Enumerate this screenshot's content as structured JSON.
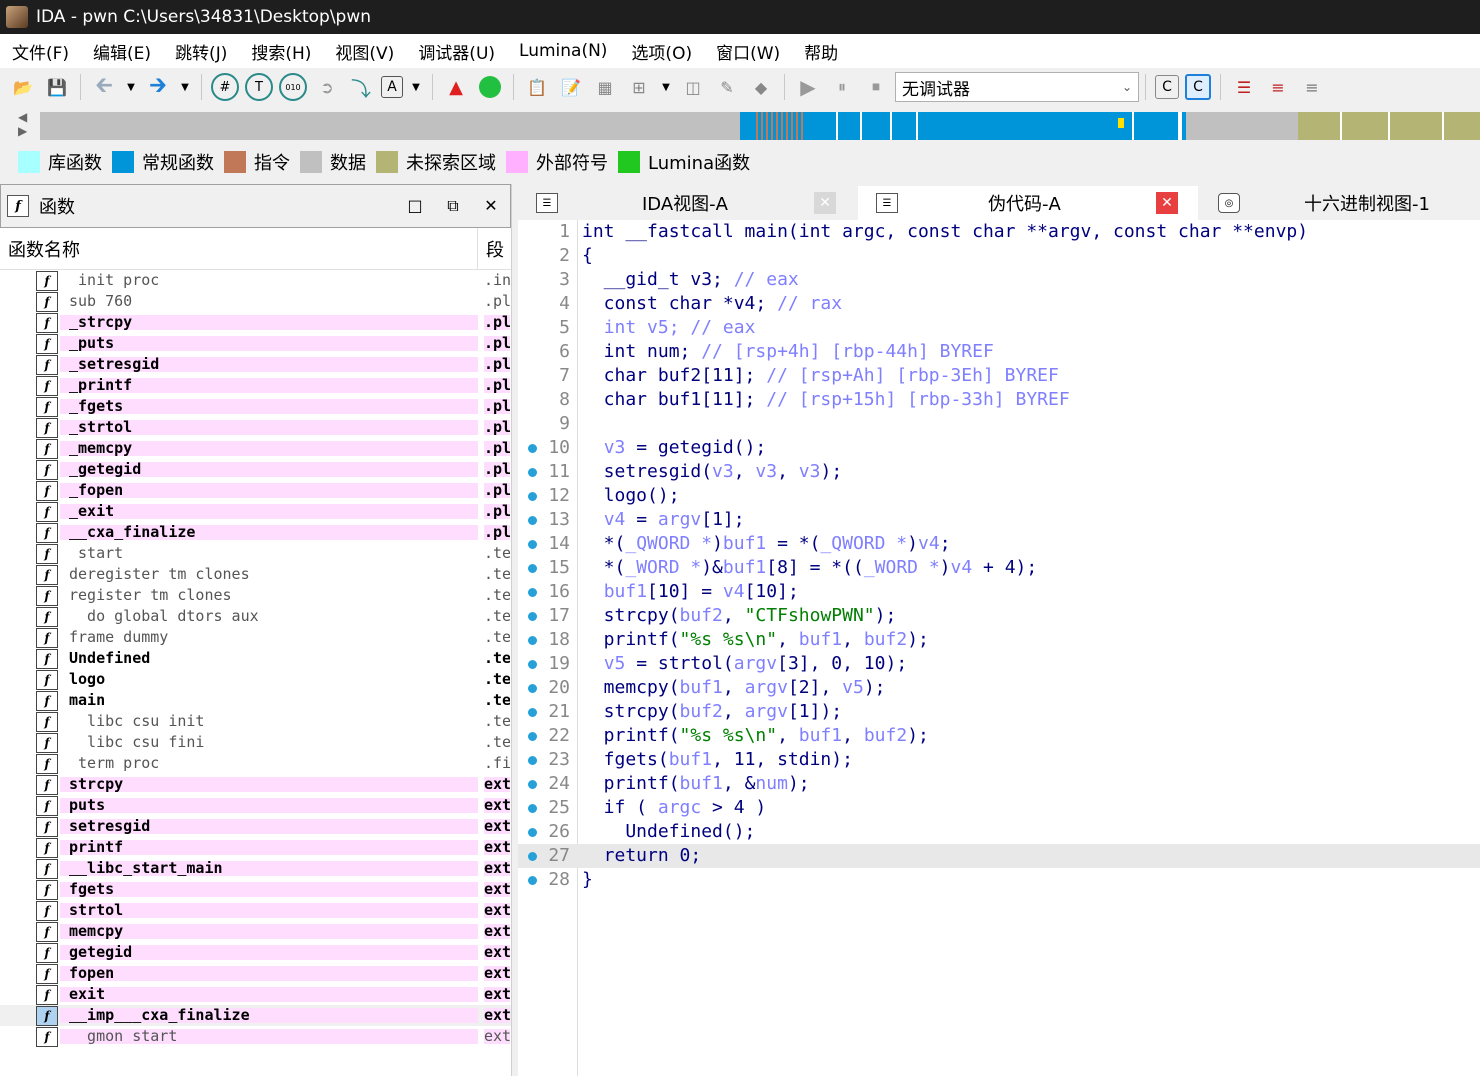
{
  "window": {
    "title": "IDA - pwn C:\\Users\\34831\\Desktop\\pwn"
  },
  "menu": [
    "文件(F)",
    "编辑(E)",
    "跳转(J)",
    "搜索(H)",
    "视图(V)",
    "调试器(U)",
    "Lumina(N)",
    "选项(O)",
    "窗口(W)",
    "帮助"
  ],
  "toolbar": {
    "icons": [
      "open-icon",
      "save-icon",
      "back-icon",
      "dropdown-icon",
      "forward-icon",
      "dropdown-icon",
      "hex-icon",
      "text-icon",
      "binary-icon",
      "jump-icon",
      "step-icon",
      "string-icon",
      "dropdown-icon",
      "graph-icon",
      "green-circle-icon",
      "copy-icon",
      "paste-icon",
      "struct-icon",
      "add-icon",
      "dropdown-icon",
      "bookmark-icon",
      "edit-icon",
      "marker-icon",
      "play-icon",
      "pause-icon",
      "stop-icon"
    ],
    "debugger_select": "无调试器",
    "right_icons": [
      "c-icon",
      "c-refresh-icon",
      "list-icon",
      "list-red-icon",
      "list-gray-icon"
    ]
  },
  "legend": [
    {
      "label": "库函数",
      "color": "#a8ffff"
    },
    {
      "label": "常规函数",
      "color": "#0094d8"
    },
    {
      "label": "指令",
      "color": "#c07858"
    },
    {
      "label": "数据",
      "color": "#c0c0c0"
    },
    {
      "label": "未探索区域",
      "color": "#b4b474"
    },
    {
      "label": "外部符号",
      "color": "#ffb0ff"
    },
    {
      "label": "Lumina函数",
      "color": "#20c820"
    }
  ],
  "functions_panel": {
    "title": "函数",
    "col_name": "函数名称",
    "col_segment": "段",
    "rows": [
      {
        "name": "_init_proc",
        "seg": ".init",
        "style": "gray"
      },
      {
        "name": "sub_760",
        "seg": ".plt",
        "style": "gray"
      },
      {
        "name": "_strcpy",
        "seg": ".plt",
        "style": "pink"
      },
      {
        "name": "_puts",
        "seg": ".plt",
        "style": "pink"
      },
      {
        "name": "_setresgid",
        "seg": ".plt",
        "style": "pink"
      },
      {
        "name": "_printf",
        "seg": ".plt",
        "style": "pink"
      },
      {
        "name": "_fgets",
        "seg": ".plt",
        "style": "pink"
      },
      {
        "name": "_strtol",
        "seg": ".plt",
        "style": "pink"
      },
      {
        "name": "_memcpy",
        "seg": ".plt",
        "style": "pink"
      },
      {
        "name": "_getegid",
        "seg": ".plt",
        "style": "pink"
      },
      {
        "name": "_fopen",
        "seg": ".plt",
        "style": "pink"
      },
      {
        "name": "_exit",
        "seg": ".plt",
        "style": "pink"
      },
      {
        "name": "__cxa_finalize",
        "seg": ".plt",
        "style": "pink"
      },
      {
        "name": "_start",
        "seg": ".text",
        "style": "gray"
      },
      {
        "name": "deregister_tm_clones",
        "seg": ".text",
        "style": "gray"
      },
      {
        "name": "register_tm_clones",
        "seg": ".text",
        "style": "gray"
      },
      {
        "name": "__do_global_dtors_aux",
        "seg": ".text",
        "style": "gray"
      },
      {
        "name": "frame_dummy",
        "seg": ".text",
        "style": "gray"
      },
      {
        "name": "Undefined",
        "seg": ".text",
        "style": "bold"
      },
      {
        "name": "logo",
        "seg": ".text",
        "style": "bold"
      },
      {
        "name": "main",
        "seg": ".text",
        "style": "bold"
      },
      {
        "name": "__libc_csu_init",
        "seg": ".text",
        "style": "gray"
      },
      {
        "name": "__libc_csu_fini",
        "seg": ".text",
        "style": "gray"
      },
      {
        "name": "_term_proc",
        "seg": ".fini",
        "style": "gray"
      },
      {
        "name": "strcpy",
        "seg": "extern",
        "style": "pink"
      },
      {
        "name": "puts",
        "seg": "extern",
        "style": "pink"
      },
      {
        "name": "setresgid",
        "seg": "extern",
        "style": "pink"
      },
      {
        "name": "printf",
        "seg": "extern",
        "style": "pink"
      },
      {
        "name": "__libc_start_main",
        "seg": "extern",
        "style": "pink"
      },
      {
        "name": "fgets",
        "seg": "extern",
        "style": "pink"
      },
      {
        "name": "strtol",
        "seg": "extern",
        "style": "pink"
      },
      {
        "name": "memcpy",
        "seg": "extern",
        "style": "pink"
      },
      {
        "name": "getegid",
        "seg": "extern",
        "style": "pink"
      },
      {
        "name": "fopen",
        "seg": "extern",
        "style": "pink"
      },
      {
        "name": "exit",
        "seg": "extern",
        "style": "pink"
      },
      {
        "name": "__imp___cxa_finalize",
        "seg": "extern",
        "style": "sel"
      },
      {
        "name": "__gmon_start__",
        "seg": "extern",
        "style": "pinkgray"
      }
    ]
  },
  "tabs": [
    {
      "label": "IDA视图-A",
      "icon": "disasm-view-icon"
    },
    {
      "label": "伪代码-A",
      "icon": "pseudocode-icon"
    },
    {
      "label": "十六进制视图-1",
      "icon": "hex-view-icon"
    }
  ],
  "code": [
    {
      "n": "1",
      "bp": false,
      "html": "int __fastcall main(int argc, const char **argv, const char **envp)"
    },
    {
      "n": "2",
      "bp": false,
      "html": "{"
    },
    {
      "n": "3",
      "bp": false,
      "html": "  __gid_t v3; <span class='cm'>// eax</span>"
    },
    {
      "n": "4",
      "bp": false,
      "html": "  const char *v4; <span class='cm'>// rax</span>"
    },
    {
      "n": "5",
      "bp": false,
      "html": "  <span class='cm'>int v5; // eax</span>"
    },
    {
      "n": "6",
      "bp": false,
      "html": "  int num; <span class='cm'>// [rsp+4h] [rbp-44h] BYREF</span>"
    },
    {
      "n": "7",
      "bp": false,
      "html": "  char buf2[11]; <span class='cm'>// [rsp+Ah] [rbp-3Eh] BYREF</span>"
    },
    {
      "n": "8",
      "bp": false,
      "html": "  char buf1[11]; <span class='cm'>// [rsp+15h] [rbp-33h] BYREF</span>"
    },
    {
      "n": "9",
      "bp": false,
      "html": ""
    },
    {
      "n": "10",
      "bp": true,
      "html": "  <span class='vr'>v3</span> = getegid();"
    },
    {
      "n": "11",
      "bp": true,
      "html": "  setresgid(<span class='vr'>v3</span>, <span class='vr'>v3</span>, <span class='vr'>v3</span>);"
    },
    {
      "n": "12",
      "bp": true,
      "html": "  logo();"
    },
    {
      "n": "13",
      "bp": true,
      "html": "  <span class='vr'>v4</span> = <span class='vr'>argv</span>[1];"
    },
    {
      "n": "14",
      "bp": true,
      "html": "  *(<span class='cm'>_QWORD *</span>)<span class='vr'>buf1</span> = *(<span class='cm'>_QWORD *</span>)<span class='vr'>v4</span>;"
    },
    {
      "n": "15",
      "bp": true,
      "html": "  *(<span class='cm'>_WORD *</span>)&amp;<span class='vr'>buf1</span>[8] = *((<span class='cm'>_WORD *</span>)<span class='vr'>v4</span> + 4);"
    },
    {
      "n": "16",
      "bp": true,
      "html": "  <span class='vr'>buf1</span>[10] = <span class='vr'>v4</span>[10];"
    },
    {
      "n": "17",
      "bp": true,
      "html": "  strcpy(<span class='vr'>buf2</span>, <span class='st'>\"CTFshowPWN\"</span>);"
    },
    {
      "n": "18",
      "bp": true,
      "html": "  printf(<span class='st'>\"%s %s\\n\"</span>, <span class='vr'>buf1</span>, <span class='vr'>buf2</span>);"
    },
    {
      "n": "19",
      "bp": true,
      "html": "  <span class='vr'>v5</span> = strtol(<span class='vr'>argv</span>[3], 0, 10);"
    },
    {
      "n": "20",
      "bp": true,
      "html": "  memcpy(<span class='vr'>buf1</span>, <span class='vr'>argv</span>[2], <span class='vr'>v5</span>);"
    },
    {
      "n": "21",
      "bp": true,
      "html": "  strcpy(<span class='vr'>buf2</span>, <span class='vr'>argv</span>[1]);"
    },
    {
      "n": "22",
      "bp": true,
      "html": "  printf(<span class='st'>\"%s %s\\n\"</span>, <span class='vr'>buf1</span>, <span class='vr'>buf2</span>);"
    },
    {
      "n": "23",
      "bp": true,
      "html": "  fgets(<span class='vr'>buf1</span>, 11, stdin);"
    },
    {
      "n": "24",
      "bp": true,
      "html": "  printf(<span class='vr'>buf1</span>, &amp;<span class='vr'>num</span>);"
    },
    {
      "n": "25",
      "bp": true,
      "html": "  if ( <span class='vr'>argc</span> &gt; 4 )"
    },
    {
      "n": "26",
      "bp": true,
      "html": "    Undefined();"
    },
    {
      "n": "27",
      "bp": true,
      "html": "  return 0;",
      "hl": true
    },
    {
      "n": "28",
      "bp": true,
      "html": "}"
    }
  ]
}
